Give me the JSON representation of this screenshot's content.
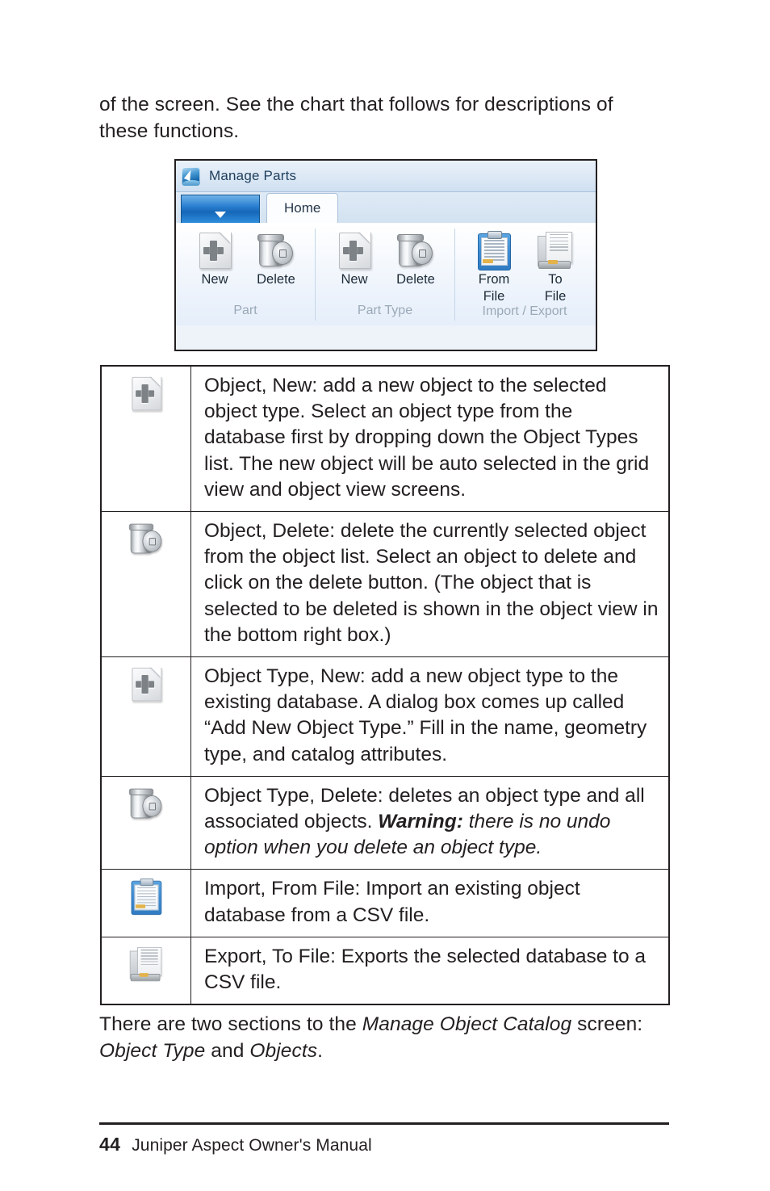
{
  "page": {
    "number": "44",
    "footer_title": "Juniper Aspect Owner's Manual"
  },
  "intro_paragraph": {
    "line1": "of the screen. See the chart that follows for descriptions",
    "line2": "of these functions."
  },
  "screenshot": {
    "app_icon": "app-arrow-icon",
    "window_title": "Manage Parts",
    "app_button": "application-menu-button",
    "tabs": [
      {
        "label": "Home",
        "active": true
      }
    ],
    "groups": [
      {
        "title": "Part",
        "items": [
          {
            "label": "New",
            "icon": "new-document-icon"
          },
          {
            "label": "Delete",
            "icon": "trash-can-icon"
          }
        ]
      },
      {
        "title": "Part Type",
        "items": [
          {
            "label": "New",
            "icon": "new-document-icon"
          },
          {
            "label": "Delete",
            "icon": "trash-can-icon"
          }
        ]
      },
      {
        "title": "Import / Export",
        "items": [
          {
            "label": "From\nFile",
            "label_line1": "From",
            "label_line2": "File",
            "icon": "clipboard-import-icon",
            "selected": true
          },
          {
            "label": "To\nFile",
            "label_line1": "To",
            "label_line2": "File",
            "icon": "document-export-icon"
          }
        ]
      }
    ],
    "colors": {
      "app_button_blue": "#1667b8",
      "titlebar_blue": "#cfe0f2",
      "selection_highlight": "#3e8bd2",
      "group_label_gray": "#9aa9b8"
    }
  },
  "table": {
    "rows": [
      {
        "icon": "new-document-icon",
        "text_plain": "Object, New: add a new object to the selected object type. Select an object type from the database first by dropping down the Object Types list. The new object will be auto selected in the grid view and object view screens."
      },
      {
        "icon": "trash-can-icon",
        "text_plain": "Object, Delete: delete the currently selected object from the object list. Select an object to delete and click on the delete button. (The object that is selected to be deleted is shown in the object view in the bottom right box.)"
      },
      {
        "icon": "new-document-icon",
        "text_plain": "Object Type, New: add a new object type to the existing database. A dialog box comes up called “Add New Object Type.” Fill in the name, geometry type, and catalog attributes."
      },
      {
        "icon": "trash-can-icon",
        "text_before": "Object Type, Delete: deletes an object type and all associated objects. ",
        "text_warning": "Warning:",
        "text_italic": " there is no undo option when you delete an object type."
      },
      {
        "icon": "clipboard-import-icon",
        "text_plain": "Import, From File: Import an existing object database from a CSV file."
      },
      {
        "icon": "document-export-icon",
        "text_plain": "Export, To File: Exports the selected database to a CSV file."
      }
    ]
  },
  "outro_paragraph": {
    "part1": "There are two sections to the ",
    "italic1": "Manage Object Catalog",
    "part2": " screen: ",
    "italic2": "Object Type",
    "part3": " and ",
    "italic3": "Objects",
    "part4": "."
  }
}
